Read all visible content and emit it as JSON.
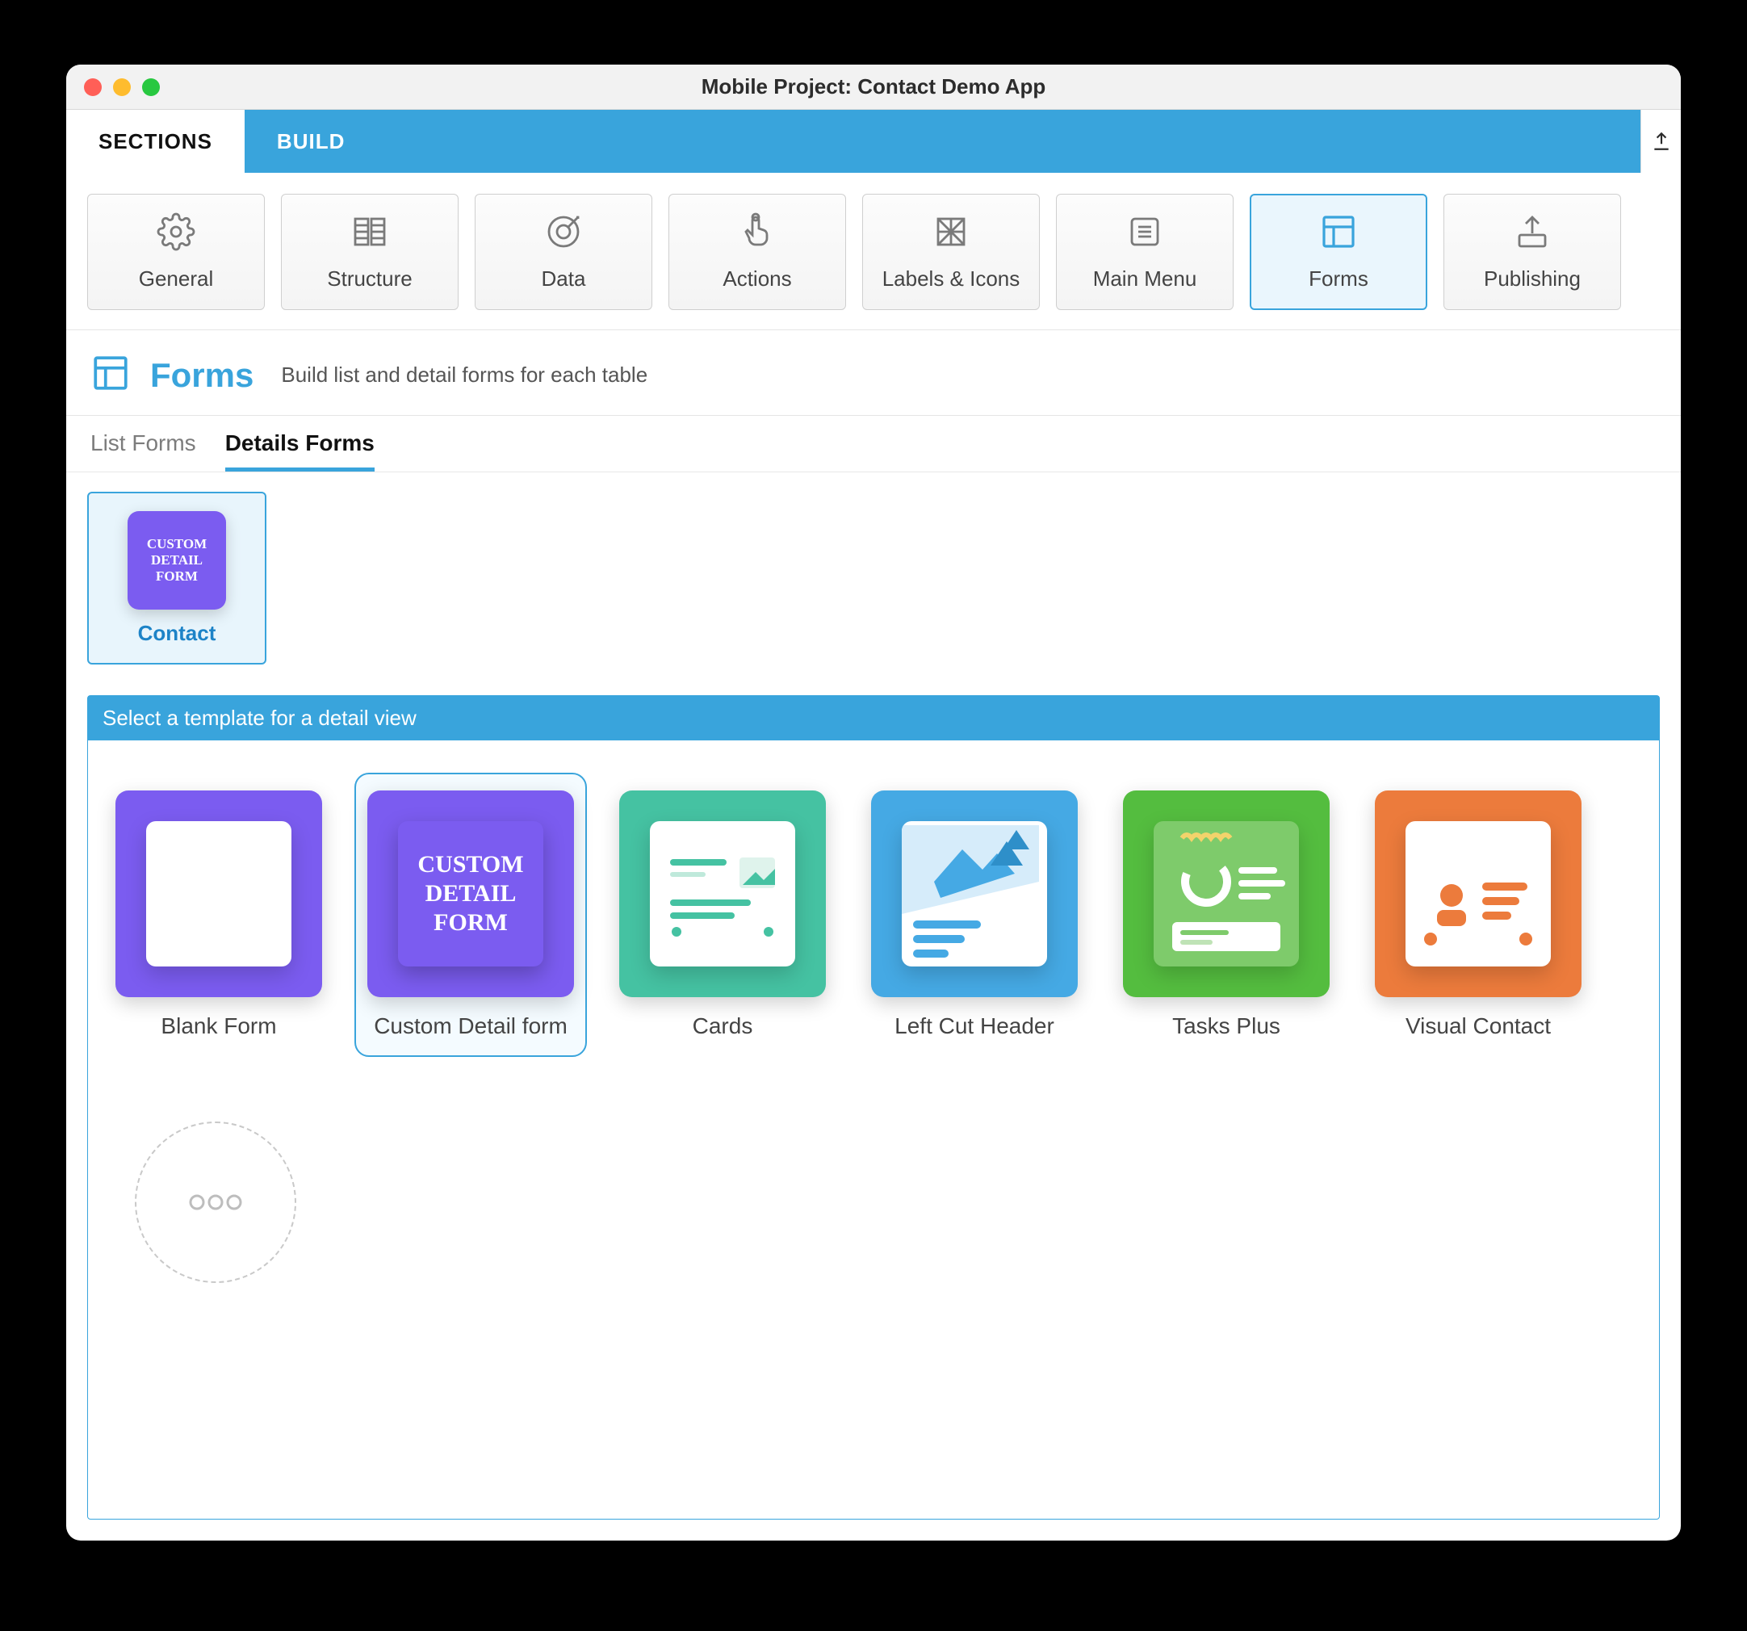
{
  "window": {
    "title": "Mobile Project: Contact Demo App"
  },
  "tabs": {
    "sections": "SECTIONS",
    "build": "BUILD"
  },
  "sections": {
    "general": "General",
    "structure": "Structure",
    "data": "Data",
    "actions": "Actions",
    "labels": "Labels & Icons",
    "mainmenu": "Main Menu",
    "forms": "Forms",
    "publishing": "Publishing"
  },
  "panel": {
    "title": "Forms",
    "desc": "Build list and detail forms for each table"
  },
  "subtabs": {
    "list": "List Forms",
    "details": "Details Forms"
  },
  "chip": {
    "label": "Contact",
    "thumb_l1": "CUSTOM",
    "thumb_l2": "DETAIL",
    "thumb_l3": "FORM"
  },
  "template_head": "Select a template for a detail view",
  "templates": {
    "blank": "Blank Form",
    "custom": "Custom Detail form",
    "cards": "Cards",
    "leftcut": "Left Cut Header",
    "tasks": "Tasks Plus",
    "visual": "Visual Contact"
  },
  "custom_tile": {
    "l1": "CUSTOM",
    "l2": "DETAIL",
    "l3": "FORM"
  }
}
